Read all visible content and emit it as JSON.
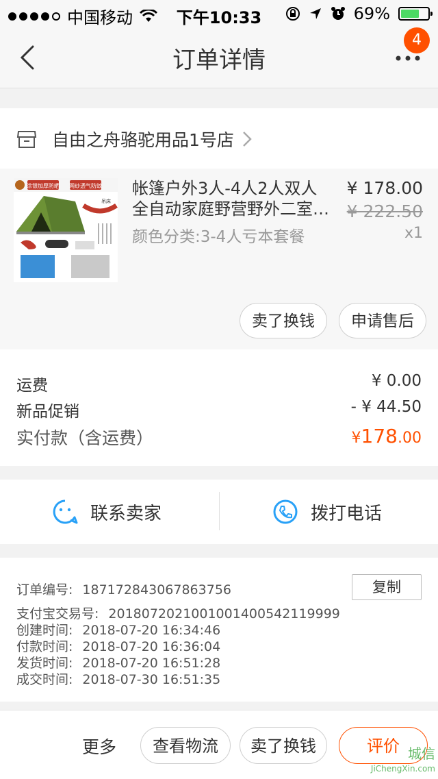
{
  "status_bar": {
    "carrier": "中国移动",
    "time": "下午10:33",
    "battery": "69%",
    "battery_level": 0.69
  },
  "nav": {
    "title": "订单详情",
    "badge_count": "4"
  },
  "shop": {
    "name": "自由之舟骆驼用品1号店"
  },
  "product": {
    "thumb_labels": [
      "涂银加厚防晒",
      "网纱透气防蚊",
      "吊床"
    ],
    "title_line1": "帐篷户外3人-4人2人双人",
    "title_line2": "全自动家庭野营野外二室…",
    "sku": "颜色分类:3-4人亏本套餐",
    "price": "¥ 178.00",
    "original_price": "¥ 222.50",
    "quantity": "x1",
    "sell_button": "卖了换钱",
    "after_sale_button": "申请售后"
  },
  "fees": {
    "shipping_label": "运费",
    "shipping_value": "¥ 0.00",
    "promo_label": "新品促销",
    "promo_value": "- ¥ 44.50",
    "total_label": "实付款（含运费）",
    "total_currency": "¥",
    "total_int": "178",
    "total_dec": ".00"
  },
  "contact": {
    "seller_label": "联系卖家",
    "phone_label": "拨打电话"
  },
  "order_info": {
    "order_no_label": "订单编号:",
    "order_no": "1871728430678637​56",
    "copy_button": "复制",
    "alipay_label": "支付宝交易号:",
    "alipay_no": "2018072021001001400542119999",
    "created_label": "创建时间:",
    "created": "2018-07-20 16:34:46",
    "paid_label": "付款时间:",
    "paid": "2018-07-20 16:36:04",
    "shipped_label": "发货时间:",
    "shipped": "2018-07-20 16:51:28",
    "completed_label": "成交时间:",
    "completed": "2018-07-30 16:51:35"
  },
  "bottom_bar": {
    "more_label": "更多",
    "logistics_button": "查看物流",
    "sell_button": "卖了换钱",
    "review_button": "评价"
  },
  "watermark": {
    "text": "城信",
    "sub": "JiChengXin.com"
  },
  "colors": {
    "accent": "#ff5000",
    "icon_blue": "#29a1f7",
    "battery_green": "#4cd964"
  }
}
